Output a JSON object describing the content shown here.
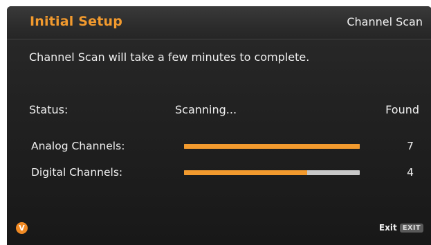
{
  "header": {
    "title": "Initial Setup",
    "section": "Channel Scan"
  },
  "message": "Channel Scan will take a few minutes to complete.",
  "status": {
    "label": "Status:",
    "value": "Scanning...",
    "found_label": "Found"
  },
  "rows": [
    {
      "label": "Analog Channels:",
      "count": "7",
      "progress": 1.0
    },
    {
      "label": "Digital Channels:",
      "count": "4",
      "progress": 0.7
    }
  ],
  "footer": {
    "logo": "V",
    "exit_label": "Exit",
    "exit_key": "EXIT"
  },
  "colors": {
    "accent": "#f29a2e",
    "track": "#c8c8c8"
  }
}
